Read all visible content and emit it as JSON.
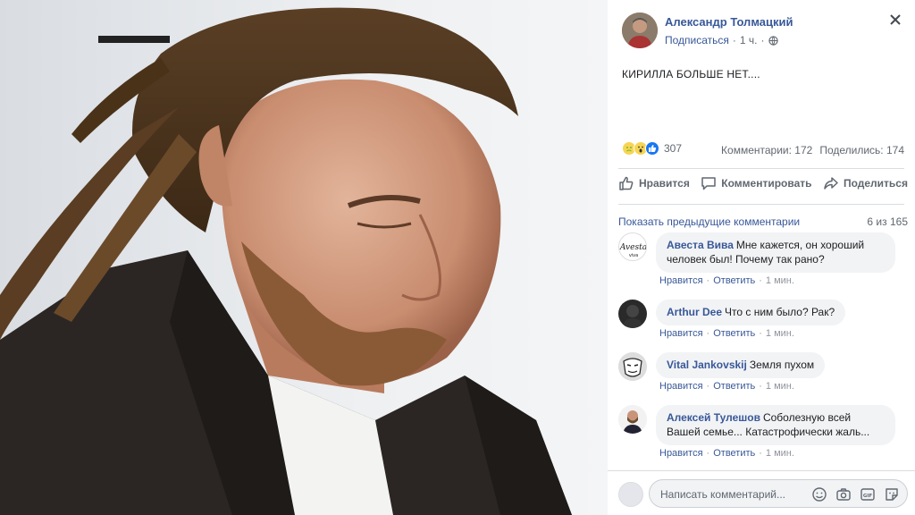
{
  "photo": {
    "description_icon": "portrait-photo"
  },
  "post": {
    "author": "Александр Толмацкий",
    "subscribe_label": "Подписаться",
    "separator": "·",
    "time": "1 ч.",
    "privacy_icon": "globe-icon",
    "text": "КИРИЛЛА БОЛЬШЕ НЕТ...."
  },
  "reactions": {
    "icons": [
      "sad-reaction-icon",
      "wow-reaction-icon",
      "like-reaction-icon"
    ],
    "count": "307",
    "comments_label": "Комментарии: 172",
    "shares_label": "Поделились: 174"
  },
  "actions": {
    "like": "Нравится",
    "comment": "Комментировать",
    "share": "Поделиться"
  },
  "comments_header": {
    "prev_label": "Показать предыдущие комментарии",
    "count_label": "6 из 165"
  },
  "comments": [
    {
      "name": "Авеста Вива",
      "text": "Мне кажется, он хороший человек был! Почему так рано?",
      "like": "Нравится",
      "reply": "Ответить",
      "sep": "·",
      "time": "1 мин."
    },
    {
      "name": "Arthur Dee",
      "text": "Что с ним было? Рак?",
      "like": "Нравится",
      "reply": "Ответить",
      "sep": "·",
      "time": "1 мин."
    },
    {
      "name": "Vital Jankovskij",
      "text": "Земля пухом",
      "like": "Нравится",
      "reply": "Ответить",
      "sep": "·",
      "time": "1 мин."
    },
    {
      "name": "Алексей Тулешов",
      "text": "Соболезную всей Вашей семье... Катастрофически жаль...",
      "like": "Нравится",
      "reply": "Ответить",
      "sep": "·",
      "time": "1 мин."
    }
  ],
  "composer": {
    "placeholder": "Написать комментарий...",
    "icons": [
      "emoji-icon",
      "camera-icon",
      "gif-icon",
      "sticker-icon"
    ],
    "gif_label": "GIF"
  },
  "colors": {
    "link": "#385898",
    "meta": "#616770",
    "bubble": "#f2f3f5",
    "like_blue": "#1877f2"
  }
}
